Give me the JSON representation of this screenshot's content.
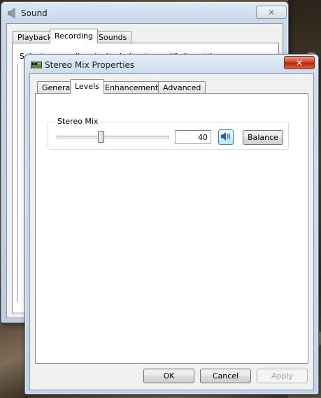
{
  "sound_window": {
    "title": "Sound",
    "tabs": [
      {
        "label": "Playback"
      },
      {
        "label": "Recording"
      },
      {
        "label": "Sounds"
      }
    ],
    "active_tab": "Recording",
    "partial_text": "Select a recording device below to modify its settings:"
  },
  "props_window": {
    "title": "Stereo Mix Properties",
    "tabs": [
      {
        "label": "General"
      },
      {
        "label": "Levels"
      },
      {
        "label": "Enhancements"
      },
      {
        "label": "Advanced"
      }
    ],
    "active_tab": "Levels",
    "group": {
      "label": "Stereo Mix",
      "level_value": "40",
      "level_fraction": 0.4,
      "balance_label": "Balance"
    },
    "buttons": {
      "ok": "OK",
      "cancel": "Cancel",
      "apply": "Apply"
    }
  },
  "icons": [
    "speaker-icon",
    "sound-card-icon",
    "close-icon",
    "speaker-volume-icon"
  ],
  "colors": {
    "accent": "#3c7fb1",
    "close_red": "#c8351f"
  }
}
